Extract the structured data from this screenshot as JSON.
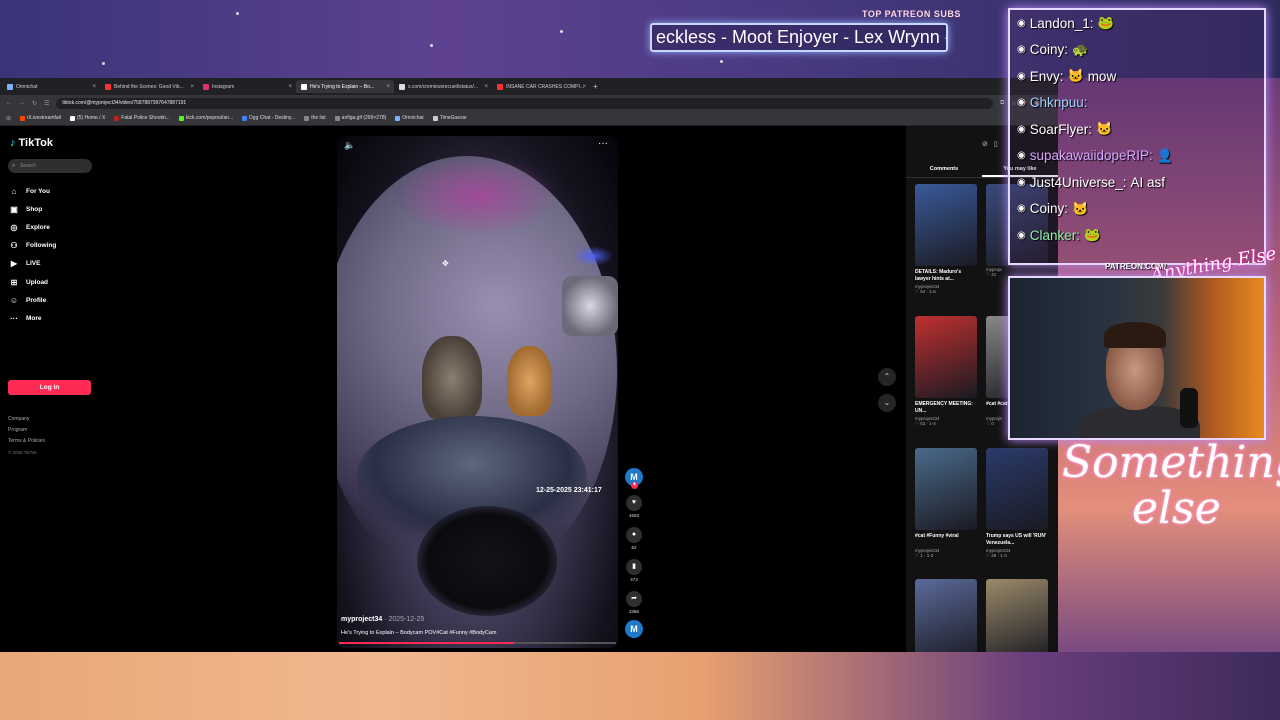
{
  "stream": {
    "patreon_label": "TOP PATREON SUBS",
    "patreon_ticker": "eckless - Moot Enjoyer - Lex Wrynn -",
    "patreon_url": "PATREON.COM/",
    "brand_script": "Anything Else",
    "overlay_script_line1": "Something",
    "overlay_script_line2": "else",
    "chat": [
      {
        "user": "Landon_1:",
        "msg": "",
        "emote": "🐸",
        "color": "#ffffff"
      },
      {
        "user": "Coiny:",
        "msg": "",
        "emote": "🐢",
        "color": "#ffffff"
      },
      {
        "user": "Envy:",
        "msg": "mow",
        "emote": "🐱",
        "color": "#ffffff"
      },
      {
        "user": "Chknpuu:",
        "msg": "",
        "emote": "",
        "color": "#9fd0ff"
      },
      {
        "user": "SoarFlyer:",
        "msg": "",
        "emote": "🐱",
        "color": "#ffffff"
      },
      {
        "user": "supakawaiidopeRIP:",
        "msg": "",
        "emote": "👤",
        "color": "#d6a8ff"
      },
      {
        "user": "Just4Universe_:",
        "msg": "AI asf",
        "emote": "",
        "color": "#ffffff"
      },
      {
        "user": "Coiny:",
        "msg": "",
        "emote": "🐱",
        "color": "#ffffff"
      },
      {
        "user": "Clanker:",
        "msg": "",
        "emote": "🐸",
        "color": "#8ff0a8"
      }
    ]
  },
  "browser": {
    "tabs": [
      {
        "label": "Omnichat",
        "color": "#7fb0ff",
        "active": false
      },
      {
        "label": "Behind the Scenes: Good Vib...",
        "color": "#ff3030",
        "active": false
      },
      {
        "label": "Instagram",
        "color": "#e1306c",
        "active": false
      },
      {
        "label": "He's Trying to Explain – Bo...",
        "color": "#ffffff",
        "active": true
      },
      {
        "label": "x.com/cremieuxrecueil/status/...",
        "color": "#dddddd",
        "active": false
      },
      {
        "label": "INSANE CAR CRASHES COMPI...",
        "color": "#ff3030",
        "active": false
      }
    ],
    "url": "tiktok.com/@myproject34/video/7587887997647887191",
    "bookmarks": [
      {
        "label": "r/Livestreamfail",
        "color": "#ff4500"
      },
      {
        "label": "(5) Home / X",
        "color": "#ffffff"
      },
      {
        "label": "Fatal Police Shootin...",
        "color": "#c02020"
      },
      {
        "label": "kick.com/popout/an...",
        "color": "#53fc18"
      },
      {
        "label": "Dgg Chat - Destiny...",
        "color": "#4080ff"
      },
      {
        "label": "the list",
        "color": "#888888"
      },
      {
        "label": "anfiga.gif (299×278)",
        "color": "#888888"
      },
      {
        "label": "Omnichat",
        "color": "#7fb0ff"
      },
      {
        "label": "TimeGuessr",
        "color": "#cccccc"
      }
    ]
  },
  "tiktok": {
    "logo": "TikTok",
    "search_placeholder": "Search",
    "nav": [
      {
        "label": "For You",
        "icon": "home-icon",
        "glyph": "⌂"
      },
      {
        "label": "Shop",
        "icon": "bag-icon",
        "glyph": "▣"
      },
      {
        "label": "Explore",
        "icon": "compass-icon",
        "glyph": "◎"
      },
      {
        "label": "Following",
        "icon": "user-icon",
        "glyph": "⚇"
      },
      {
        "label": "LIVE",
        "icon": "live-icon",
        "glyph": "▶"
      },
      {
        "label": "Upload",
        "icon": "plus-square-icon",
        "glyph": "⊞"
      },
      {
        "label": "Profile",
        "icon": "person-icon",
        "glyph": "☺"
      },
      {
        "label": "More",
        "icon": "dots-icon",
        "glyph": "···"
      }
    ],
    "login": "Log in",
    "footer": [
      "Company",
      "Program",
      "Terms & Policies"
    ],
    "copyright": "© 2026 TikTok",
    "video": {
      "timestamp": "12-25-2025 23:41:17",
      "author": "myproject34",
      "date": "· 2025-12-25",
      "caption": "He's Trying to Explain – Bodycam POV#Cat #Funny #BodyCam",
      "progress": 0.63
    },
    "actions": {
      "avatar_letter": "M",
      "likes": "4693",
      "comments": "62",
      "saves": "473",
      "shares": "3386"
    },
    "right_panel": {
      "tabs": [
        "Comments",
        "You may like"
      ],
      "videos": [
        {
          "title": "DETAILS: Maduro's lawyer hints at...",
          "author": "myproject34",
          "stats": "♡ 54 · 1-6",
          "color": "#3a5a9a"
        },
        {
          "title": "",
          "author": "myproje",
          "stats": "♡ 41",
          "color": "#3a4a7a"
        },
        {
          "title": "EMERGENCY MEETING: UN...",
          "author": "myproject34",
          "stats": "♡ 53 · 1-4",
          "color": "#c03030"
        },
        {
          "title": "#cat #cats...",
          "author": "myproje",
          "stats": "♡ 0",
          "color": "#888888"
        },
        {
          "title": "#cat #Funny #viral",
          "author": "myproject34",
          "stats": "♡ 1 · 1-3",
          "color": "#4a6a8a"
        },
        {
          "title": "Trump says US will 'RUN' Venezuela...",
          "author": "myproject34",
          "stats": "♡ 29 · 1-3",
          "color": "#2a3a6a"
        },
        {
          "title": "",
          "author": "",
          "stats": "",
          "color": "#5a6a9a"
        },
        {
          "title": "",
          "author": "",
          "stats": "",
          "color": "#9a8a6a"
        }
      ]
    }
  }
}
